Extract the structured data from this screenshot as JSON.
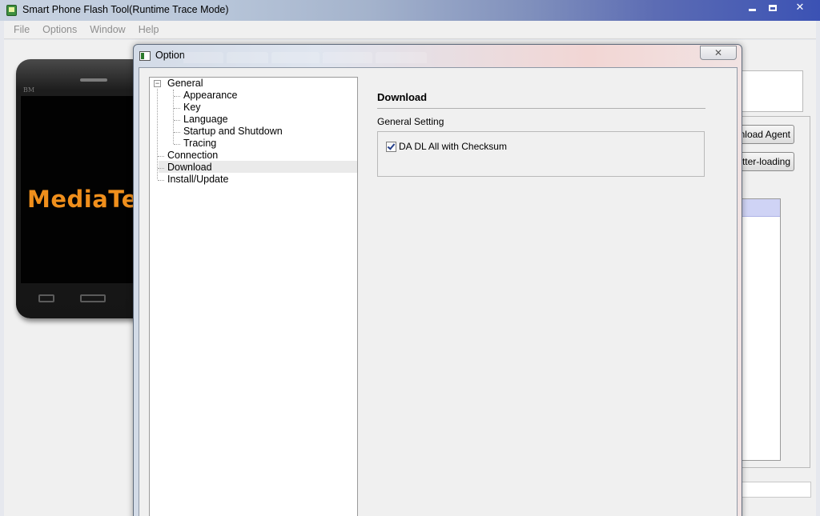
{
  "app": {
    "title": "Smart Phone Flash Tool(Runtime Trace Mode)",
    "window_buttons": [
      "minimize",
      "maximize",
      "close"
    ],
    "close_glyph": "✕"
  },
  "menubar": {
    "items": [
      "File",
      "Options",
      "Window",
      "Help"
    ]
  },
  "phone": {
    "brand": "BM",
    "logo": "MediaTe"
  },
  "main_buttons": {
    "download_agent": "ownload Agent",
    "scatter_loading": "tter-loading"
  },
  "dialog": {
    "title": "Option",
    "close_glyph": "✕",
    "tree": {
      "expander": "−",
      "root": "General",
      "children": [
        "Appearance",
        "Key",
        "Language",
        "Startup and Shutdown",
        "Tracing"
      ],
      "siblings": [
        "Connection",
        "Download",
        "Install/Update"
      ],
      "selected": "Download"
    },
    "pane": {
      "heading": "Download",
      "group_title": "General Setting",
      "checkbox_label": "DA DL All with Checksum",
      "checkbox_checked": true
    }
  },
  "colors": {
    "logo_orange": "#f08f1c",
    "check_blue": "#233e8a",
    "list_selection": "#cfd3f5"
  }
}
